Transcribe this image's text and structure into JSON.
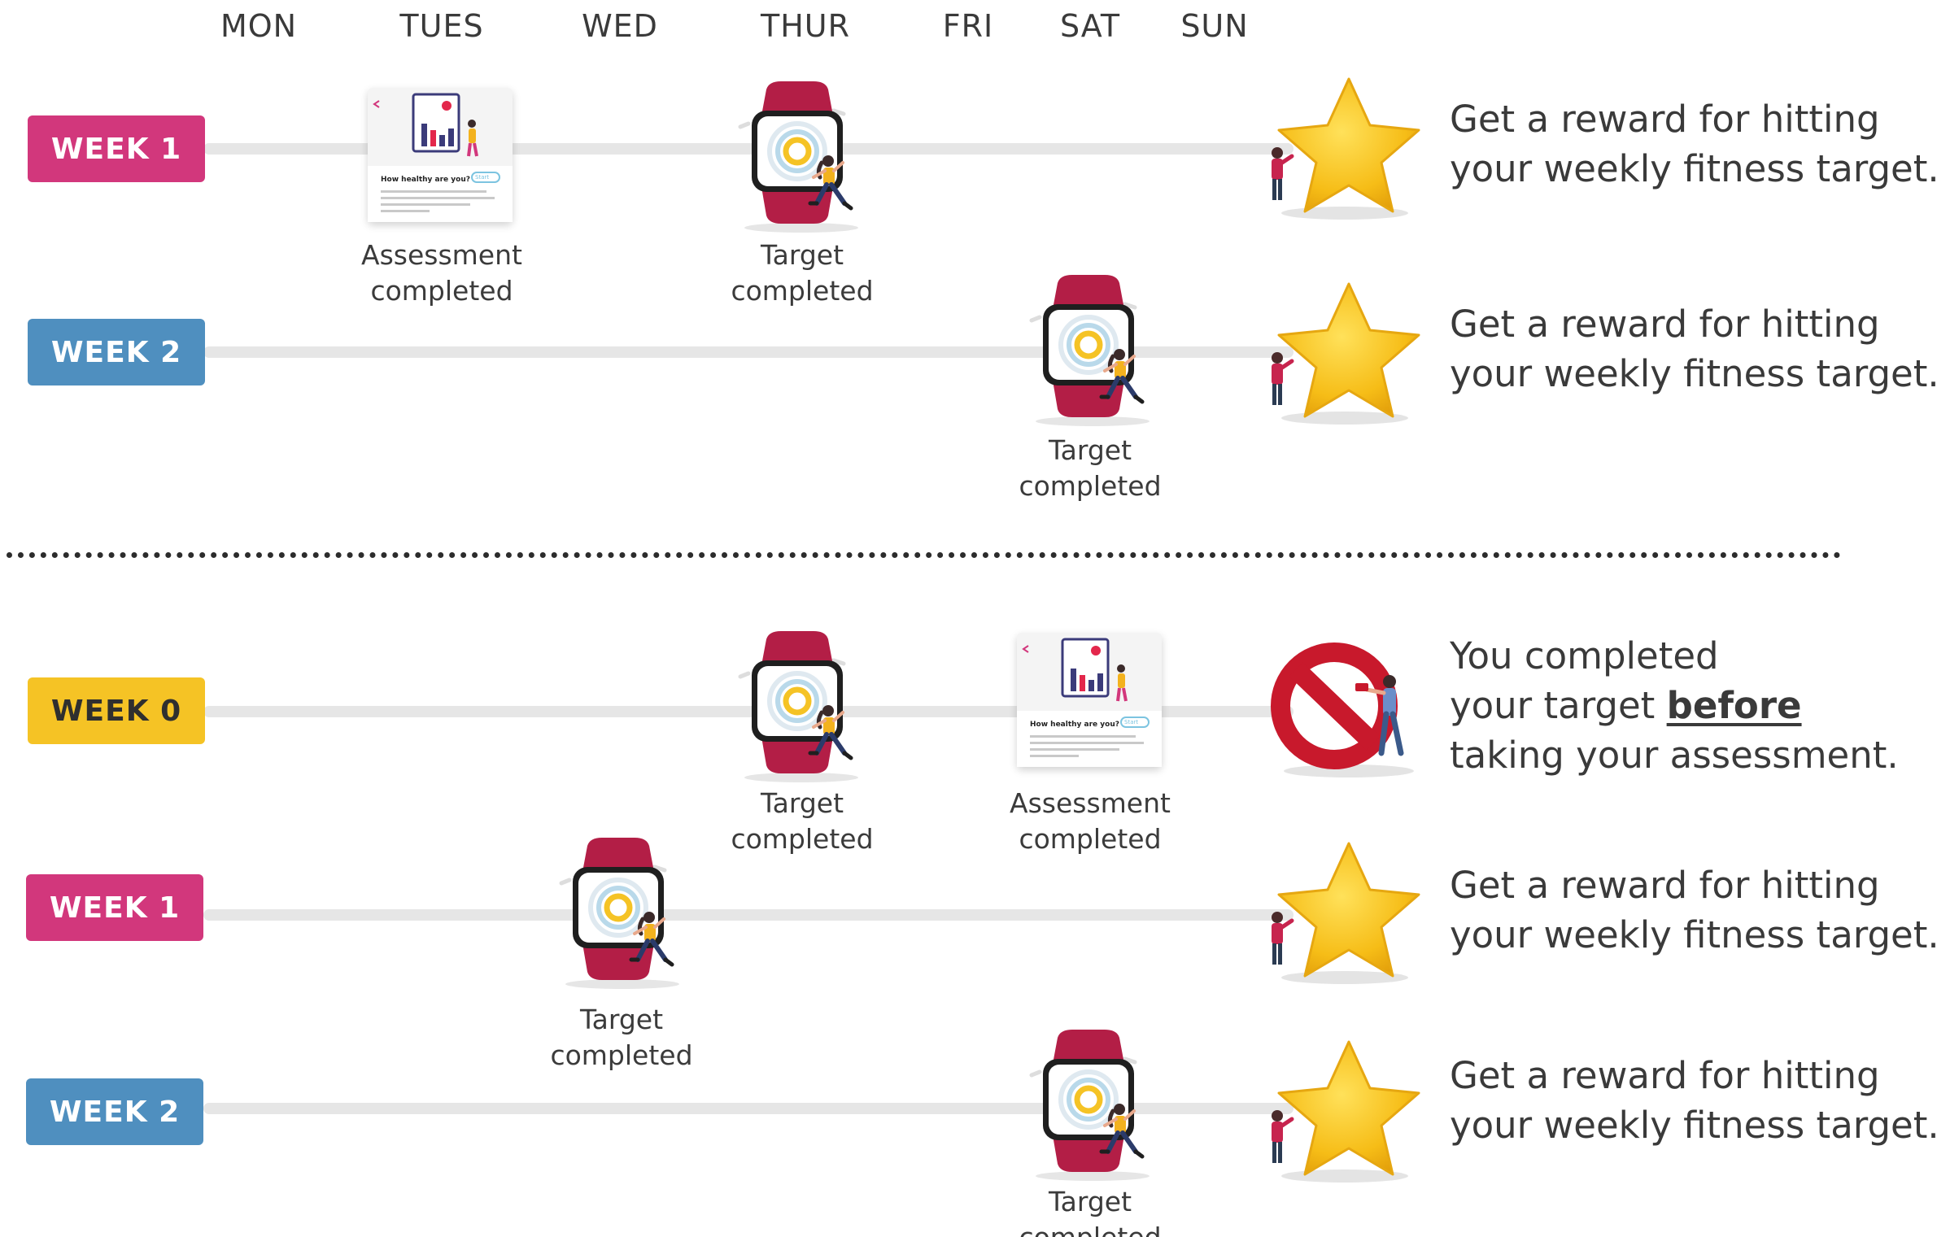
{
  "days": [
    "MON",
    "TUES",
    "WED",
    "THUR",
    "FRI",
    "SAT",
    "SUN"
  ],
  "top_scenario": {
    "rows": [
      {
        "label": "WEEK 1",
        "color": "#d2377c",
        "events": [
          {
            "type": "assessment",
            "day": "TUES",
            "caption": [
              "Assessment",
              "completed"
            ]
          },
          {
            "type": "target",
            "day": "THUR",
            "caption": [
              "Target",
              "completed"
            ]
          }
        ],
        "outcome": {
          "icon": "star-icon",
          "text": [
            "Get a reward for hitting",
            "your weekly fitness target."
          ]
        }
      },
      {
        "label": "WEEK 2",
        "color": "#4f8fbf",
        "events": [
          {
            "type": "target",
            "day": "SAT",
            "caption": [
              "Target",
              "completed"
            ]
          }
        ],
        "outcome": {
          "icon": "star-icon",
          "text": [
            "Get a reward for hitting",
            "your weekly fitness target."
          ]
        }
      }
    ]
  },
  "bottom_scenario": {
    "rows": [
      {
        "label": "WEEK 0",
        "color": "#f5c325",
        "events": [
          {
            "type": "target",
            "day": "THUR",
            "caption": [
              "Target",
              "completed"
            ]
          },
          {
            "type": "assessment",
            "day": "SAT",
            "caption": [
              "Assessment",
              "completed"
            ]
          }
        ],
        "outcome": {
          "icon": "prohibited-icon",
          "text_line1": "You completed",
          "text_line2_pre": "your target ",
          "text_line2_emph": "before",
          "text_line3": "taking your assessment."
        }
      },
      {
        "label": "WEEK 1",
        "color": "#d2377c",
        "events": [
          {
            "type": "target",
            "day": "WED",
            "caption": [
              "Target",
              "completed"
            ]
          }
        ],
        "outcome": {
          "icon": "star-icon",
          "text": [
            "Get a reward for hitting",
            "your weekly fitness target."
          ]
        }
      },
      {
        "label": "WEEK 2",
        "color": "#4f8fbf",
        "events": [
          {
            "type": "target",
            "day": "SAT",
            "caption": [
              "Target",
              "completed"
            ]
          }
        ],
        "outcome": {
          "icon": "star-icon",
          "text": [
            "Get a reward for hitting",
            "your weekly fitness target."
          ]
        }
      }
    ]
  },
  "assessment_card": {
    "heading": "How healthy are you?",
    "button": "Start"
  }
}
